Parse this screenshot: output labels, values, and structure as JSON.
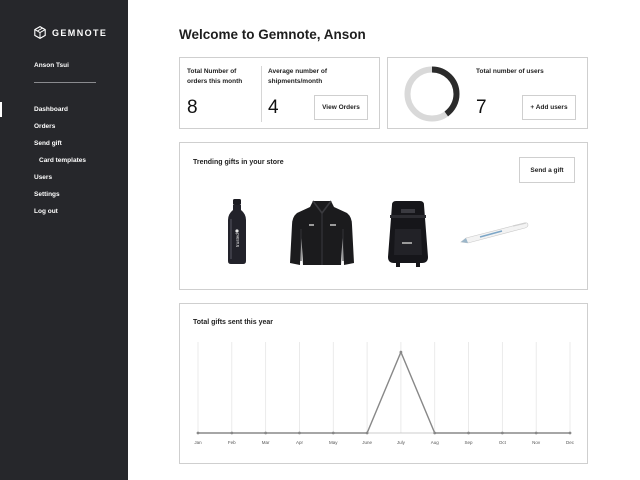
{
  "sidebar": {
    "brand": "GEMNOTE",
    "user": "Anson Tsui",
    "items": [
      {
        "label": "Dashboard",
        "active": true,
        "sub": false
      },
      {
        "label": "Orders",
        "active": false,
        "sub": false
      },
      {
        "label": "Send gift",
        "active": false,
        "sub": false
      },
      {
        "label": "Card templates",
        "active": false,
        "sub": true
      },
      {
        "label": "Users",
        "active": false,
        "sub": false
      },
      {
        "label": "Settings",
        "active": false,
        "sub": false
      },
      {
        "label": "Log out",
        "active": false,
        "sub": false
      }
    ]
  },
  "page": {
    "title": "Welcome to Gemnote, Anson"
  },
  "orders_card": {
    "total_label": "Total Number of orders this month",
    "total_value": "8",
    "avg_label": "Average number of shipments/month",
    "avg_value": "4",
    "view_button": "View Orders"
  },
  "users_card": {
    "label": "Total number of users",
    "value": "7",
    "add_button": "+ Add users",
    "ring_fill_fraction": 0.4
  },
  "trending": {
    "title": "Trending gifts in your store",
    "send_button": "Send a gift",
    "gifts": [
      {
        "name": "water-bottle",
        "icon": "bottle-icon"
      },
      {
        "name": "fleece-jacket",
        "icon": "jacket-icon"
      },
      {
        "name": "backpack",
        "icon": "backpack-icon"
      },
      {
        "name": "pen",
        "icon": "pen-icon"
      }
    ]
  },
  "chart_data": {
    "type": "line",
    "title": "Total gifts sent this year",
    "categories": [
      "Jan",
      "Feb",
      "Mar",
      "Apr",
      "May",
      "June",
      "July",
      "Aug",
      "Sep",
      "Oct",
      "Nov",
      "Dec"
    ],
    "series": [
      {
        "values": [
          0,
          0,
          0,
          0,
          0,
          0,
          8,
          0,
          0,
          0,
          0,
          0
        ]
      }
    ],
    "ylim": [
      0,
      9
    ],
    "grid": "vertical",
    "colors": {
      "line": "#888888",
      "grid": "#e6e6e6",
      "ring_bg": "#d9d9d9",
      "ring_fg": "#2b2b2b"
    }
  }
}
